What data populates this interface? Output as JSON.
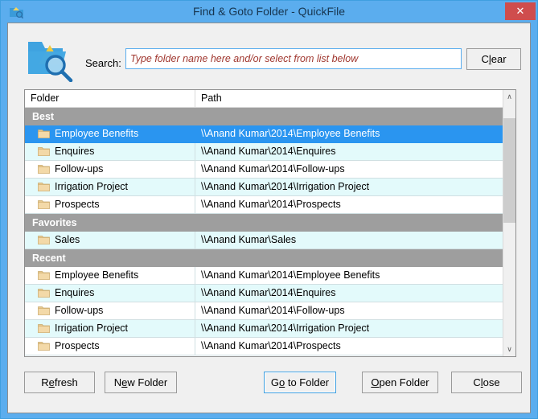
{
  "window": {
    "title": "Find & Goto Folder - QuickFile",
    "title_icon": "folder-search-icon",
    "close_label": "✕",
    "accent_color": "#5badee",
    "close_color": "#cf4d4d"
  },
  "search": {
    "app_icon": "folder-magnifier-icon",
    "label": "Search:",
    "value": "",
    "placeholder": "Type folder name here and/or select from list below",
    "placeholder_color": "#a0372f",
    "clear_button": {
      "pre": "C",
      "accel": "l",
      "post": "ear"
    }
  },
  "listview": {
    "columns": [
      "Folder",
      "Path"
    ],
    "selection_color": "#2a95f0",
    "group_header_color": "#9e9e9e",
    "alt_row_color": "#e3fafb",
    "groups": [
      {
        "name": "Best",
        "items": [
          {
            "folder": "Employee Benefits",
            "path": "\\\\Anand Kumar\\2014\\Employee Benefits",
            "selected": true
          },
          {
            "folder": "Enquires",
            "path": "\\\\Anand Kumar\\2014\\Enquires",
            "selected": false
          },
          {
            "folder": "Follow-ups",
            "path": "\\\\Anand Kumar\\2014\\Follow-ups",
            "selected": false
          },
          {
            "folder": "Irrigation Project",
            "path": "\\\\Anand Kumar\\2014\\Irrigation Project",
            "selected": false
          },
          {
            "folder": "Prospects",
            "path": "\\\\Anand Kumar\\2014\\Prospects",
            "selected": false
          }
        ]
      },
      {
        "name": "Favorites",
        "items": [
          {
            "folder": "Sales",
            "path": "\\\\Anand Kumar\\Sales",
            "selected": false
          }
        ]
      },
      {
        "name": "Recent",
        "items": [
          {
            "folder": "Employee Benefits",
            "path": "\\\\Anand Kumar\\2014\\Employee Benefits",
            "selected": false
          },
          {
            "folder": "Enquires",
            "path": "\\\\Anand Kumar\\2014\\Enquires",
            "selected": false
          },
          {
            "folder": "Follow-ups",
            "path": "\\\\Anand Kumar\\2014\\Follow-ups",
            "selected": false
          },
          {
            "folder": "Irrigation Project",
            "path": "\\\\Anand Kumar\\2014\\Irrigation Project",
            "selected": false
          },
          {
            "folder": "Prospects",
            "path": "\\\\Anand Kumar\\2014\\Prospects",
            "selected": false
          }
        ]
      }
    ],
    "scrollbar": {
      "up_arrow": "∧",
      "down_arrow": "∨",
      "thumb_top_pct": 6,
      "thumb_height_pct": 44
    }
  },
  "buttons": [
    {
      "id": "refresh",
      "pre": "R",
      "accel": "e",
      "post": "fresh",
      "focused": false
    },
    {
      "id": "new-folder",
      "pre": "N",
      "accel": "e",
      "post": "w Folder",
      "focused": false
    },
    {
      "id": "goto",
      "pre": "G",
      "accel": "o",
      "post": " to Folder",
      "focused": true
    },
    {
      "id": "open",
      "pre": "",
      "accel": "O",
      "post": "pen Folder",
      "focused": false
    },
    {
      "id": "close",
      "pre": "C",
      "accel": "l",
      "post": "ose",
      "focused": false
    }
  ]
}
